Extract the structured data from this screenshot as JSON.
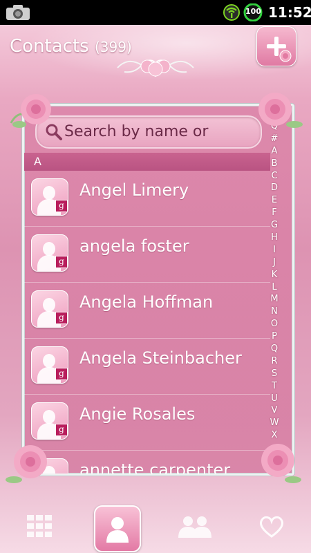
{
  "status_bar": {
    "time": "11:52",
    "battery_level": "100",
    "icons": [
      "camera-icon",
      "wifi-icon",
      "battery-icon"
    ]
  },
  "header": {
    "title": "Contacts",
    "count": "(399)",
    "add_button_icon": "plus-icon"
  },
  "search": {
    "placeholder": "Search by name or",
    "icon": "search-icon"
  },
  "section_letter": "A",
  "contacts": [
    {
      "name": "Angel Limery",
      "badge": "g"
    },
    {
      "name": "angela foster",
      "badge": "g"
    },
    {
      "name": "Angela Hoffman",
      "badge": "g"
    },
    {
      "name": "Angela Steinbacher",
      "badge": "g"
    },
    {
      "name": "Angie Rosales",
      "badge": "g"
    },
    {
      "name": "annette carpenter",
      "badge": "g"
    }
  ],
  "alphabet_index": [
    "Q",
    "#",
    "A",
    "B",
    "C",
    "D",
    "E",
    "F",
    "G",
    "H",
    "I",
    "J",
    "K",
    "L",
    "M",
    "N",
    "O",
    "P",
    "Q",
    "R",
    "S",
    "T",
    "U",
    "V",
    "W",
    "X"
  ],
  "bottom_nav": [
    {
      "name": "dialer",
      "icon": "dialpad-icon"
    },
    {
      "name": "contacts",
      "icon": "contact-person-icon",
      "selected": true
    },
    {
      "name": "groups",
      "icon": "group-icon"
    },
    {
      "name": "favorites",
      "icon": "heart-icon"
    }
  ],
  "colors": {
    "accent": "#e07aa3",
    "panel": "#d884a8",
    "section_header": "#c9638f",
    "status_bar": "#000000"
  }
}
